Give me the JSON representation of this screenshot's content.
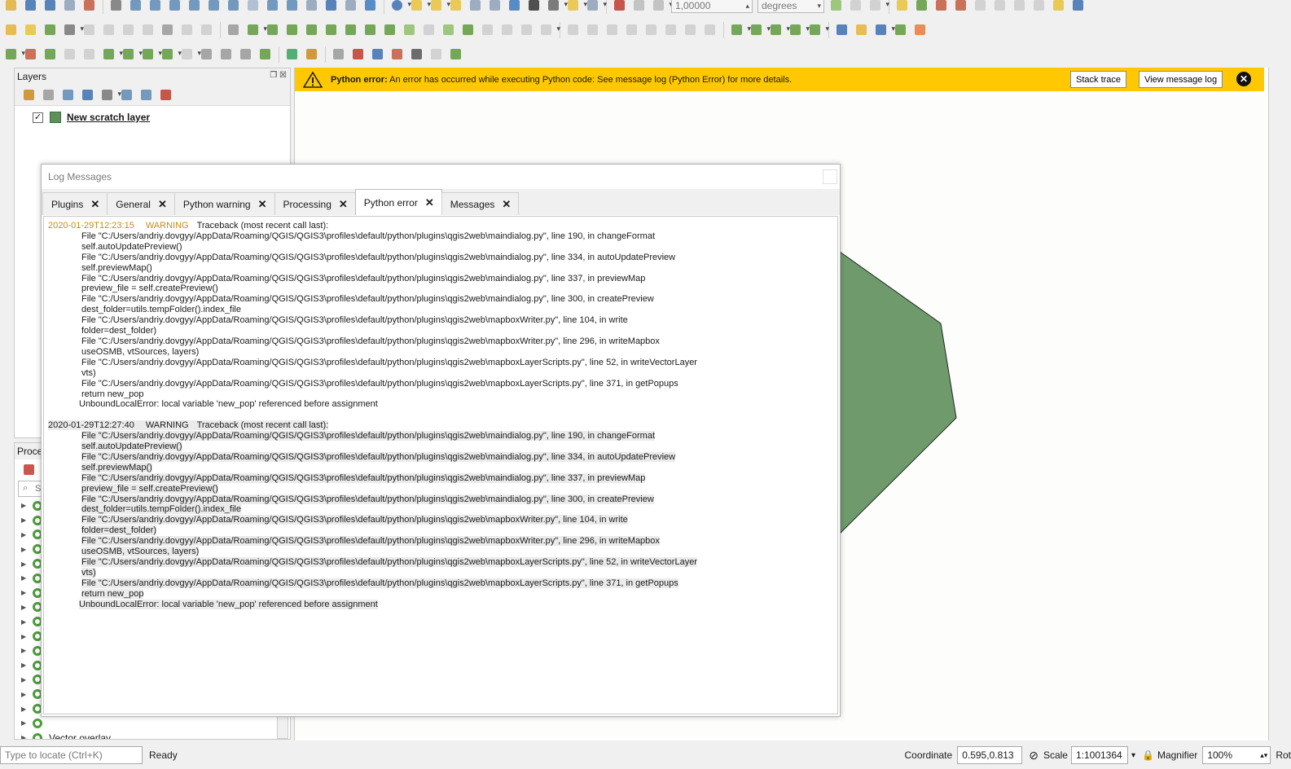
{
  "toolbar": {
    "scale_value": "1,00000",
    "units_value": "degrees"
  },
  "layers_panel": {
    "title": "Layers",
    "layer_name": "New scratch layer"
  },
  "processing_panel": {
    "title": "Proce",
    "search_placeholder": "S",
    "visible_item": "Vector overlay"
  },
  "error_bar": {
    "bold": "Python error:",
    "message": " An error has occurred while executing Python code: See message log (Python Error) for more details.",
    "stack_trace": "Stack trace",
    "view_log": "View message log",
    "close": "✕"
  },
  "log_dialog": {
    "title": "Log Messages",
    "tabs": [
      "Plugins",
      "General",
      "Python warning",
      "Processing",
      "Python error",
      "Messages"
    ],
    "active_tab": "Python error",
    "entries": [
      {
        "timestamp": "2020-01-29T12:23:15",
        "level": "WARNING",
        "header": "Traceback (most recent call last):",
        "lines": [
          "File \"C:/Users/andriy.dovgyy/AppData/Roaming/QGIS/QGIS3\\profiles\\default/python/plugins\\qgis2web\\maindialog.py\", line 190, in changeFormat",
          "self.autoUpdatePreview()",
          "File \"C:/Users/andriy.dovgyy/AppData/Roaming/QGIS/QGIS3\\profiles\\default/python/plugins\\qgis2web\\maindialog.py\", line 334, in autoUpdatePreview",
          "self.previewMap()",
          "File \"C:/Users/andriy.dovgyy/AppData/Roaming/QGIS/QGIS3\\profiles\\default/python/plugins\\qgis2web\\maindialog.py\", line 337, in previewMap",
          "preview_file = self.createPreview()",
          "File \"C:/Users/andriy.dovgyy/AppData/Roaming/QGIS/QGIS3\\profiles\\default/python/plugins\\qgis2web\\maindialog.py\", line 300, in createPreview",
          "dest_folder=utils.tempFolder().index_file",
          "File \"C:/Users/andriy.dovgyy/AppData/Roaming/QGIS/QGIS3\\profiles\\default/python/plugins\\qgis2web\\mapboxWriter.py\", line 104, in write",
          "folder=dest_folder)",
          "File \"C:/Users/andriy.dovgyy/AppData/Roaming/QGIS/QGIS3\\profiles\\default/python/plugins\\qgis2web\\mapboxWriter.py\", line 296, in writeMapbox",
          "useOSMB, vtSources, layers)",
          "File \"C:/Users/andriy.dovgyy/AppData/Roaming/QGIS/QGIS3\\profiles\\default/python/plugins\\qgis2web\\mapboxLayerScripts.py\", line 52, in writeVectorLayer",
          "vts)",
          "File \"C:/Users/andriy.dovgyy/AppData/Roaming/QGIS/QGIS3\\profiles\\default/python/plugins\\qgis2web\\mapboxLayerScripts.py\", line 371, in getPopups",
          "return new_pop"
        ],
        "error": "UnboundLocalError: local variable 'new_pop' referenced before assignment"
      },
      {
        "timestamp": "2020-01-29T12:27:40",
        "level": "WARNING",
        "header": "Traceback (most recent call last):",
        "lines": [
          "File \"C:/Users/andriy.dovgyy/AppData/Roaming/QGIS/QGIS3\\profiles\\default/python/plugins\\qgis2web\\maindialog.py\", line 190, in changeFormat",
          "self.autoUpdatePreview()",
          "File \"C:/Users/andriy.dovgyy/AppData/Roaming/QGIS/QGIS3\\profiles\\default/python/plugins\\qgis2web\\maindialog.py\", line 334, in autoUpdatePreview",
          "self.previewMap()",
          "File \"C:/Users/andriy.dovgyy/AppData/Roaming/QGIS/QGIS3\\profiles\\default/python/plugins\\qgis2web\\maindialog.py\", line 337, in previewMap",
          "preview_file = self.createPreview()",
          "File \"C:/Users/andriy.dovgyy/AppData/Roaming/QGIS/QGIS3\\profiles\\default/python/plugins\\qgis2web\\maindialog.py\", line 300, in createPreview",
          "dest_folder=utils.tempFolder().index_file",
          "File \"C:/Users/andriy.dovgyy/AppData/Roaming/QGIS/QGIS3\\profiles\\default/python/plugins\\qgis2web\\mapboxWriter.py\", line 104, in write",
          "folder=dest_folder)",
          "File \"C:/Users/andriy.dovgyy/AppData/Roaming/QGIS/QGIS3\\profiles\\default/python/plugins\\qgis2web\\mapboxWriter.py\", line 296, in writeMapbox",
          "useOSMB, vtSources, layers)",
          "File \"C:/Users/andriy.dovgyy/AppData/Roaming/QGIS/QGIS3\\profiles\\default/python/plugins\\qgis2web\\mapboxLayerScripts.py\", line 52, in writeVectorLayer",
          "vts)",
          "File \"C:/Users/andriy.dovgyy/AppData/Roaming/QGIS/QGIS3\\profiles\\default/python/plugins\\qgis2web\\mapboxLayerScripts.py\", line 371, in getPopups",
          "return new_pop"
        ],
        "error": "UnboundLocalError: local variable 'new_pop' referenced before assignment"
      }
    ]
  },
  "status_bar": {
    "locator_placeholder": "Type to locate (Ctrl+K)",
    "status": "Ready",
    "coordinate_label": "Coordinate",
    "coordinate_value": "0.595,0.813",
    "scale_label": "Scale",
    "scale_value": "1:1001364",
    "magnifier_label": "Magnifier",
    "magnifier_value": "100%",
    "rotation_label": "Rot"
  },
  "colors": {
    "banner": "#ffc800",
    "polygon_fill": "#6f9a6c",
    "warning_text": "#c98a1e"
  }
}
